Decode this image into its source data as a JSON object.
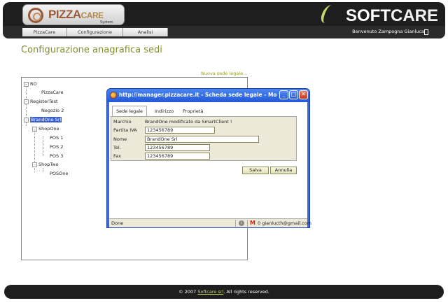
{
  "header": {
    "logo_main": "PIZZA",
    "logo_accent": "CARE",
    "logo_sub": "System",
    "brand_soft": "SOFT",
    "brand_care": "CARE",
    "welcome": "Benvenuto Zampogna Gianluca"
  },
  "nav": {
    "items": [
      {
        "label": "PizzaCare"
      },
      {
        "label": "Configurazione"
      },
      {
        "label": "Analisi"
      }
    ]
  },
  "page": {
    "title": "Configurazione anagrafica sedi",
    "new_link": "Nuova sede legale..."
  },
  "tree": {
    "nodes": [
      {
        "label": "RO",
        "expander": "-"
      },
      {
        "label": "PizzaCare"
      },
      {
        "label": "RegisterTest",
        "expander": "-"
      },
      {
        "label": "Negozio 2"
      },
      {
        "label": "BrandOne Srl",
        "expander": "-",
        "selected": true
      },
      {
        "label": "ShopOne",
        "expander": "-"
      },
      {
        "label": "POS 1"
      },
      {
        "label": "POS 2"
      },
      {
        "label": "POS 3"
      },
      {
        "label": "ShopTwo",
        "expander": "-"
      },
      {
        "label": "POSOne"
      }
    ]
  },
  "popup": {
    "title": "http://manager.pizzacare.it - Scheda sede legale - Moz...",
    "tabs": [
      {
        "label": "Sede legale",
        "active": true
      },
      {
        "label": "Indirizzo"
      },
      {
        "label": "Proprietà"
      }
    ],
    "fields": [
      {
        "label": "Marchio",
        "value": "BrandOne modificato da SmartClient !"
      },
      {
        "label": "Partita IVA",
        "value": "123456789"
      },
      {
        "label": "Nome",
        "value": "BrandOne Srl"
      },
      {
        "label": "Tel.",
        "value": "123456789"
      },
      {
        "label": "Fax",
        "value": "123456789"
      }
    ],
    "save_label": "Salva",
    "cancel_label": "Annulla",
    "status_done": "Done",
    "status_mail": "0 gianlucth@gmail.com"
  },
  "footer": {
    "prefix": "© 2007",
    "link": "Softcare srl",
    "suffix": ". All rights reserved."
  }
}
